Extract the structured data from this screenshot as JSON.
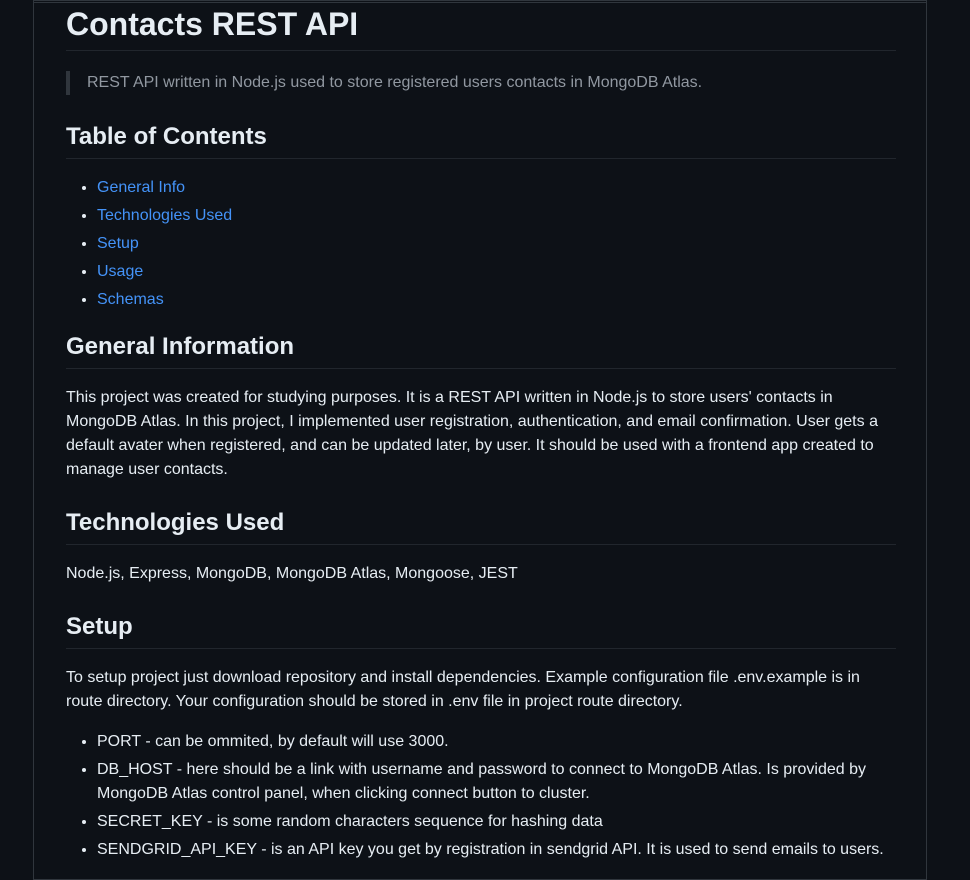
{
  "title": "Contacts REST API",
  "tagline": "REST API written in Node.js used to store registered users contacts in MongoDB Atlas.",
  "toc": {
    "heading": "Table of Contents",
    "items": [
      "General Info",
      "Technologies Used",
      "Setup",
      "Usage",
      "Schemas"
    ]
  },
  "general": {
    "heading": "General Information",
    "text": "This project was created for studying purposes. It is a REST API written in Node.js to store users' contacts in MongoDB Atlas. In this project, I implemented user registration, authentication, and email confirmation. User gets a default avater when registered, and can be updated later, by user. It should be used with a frontend app created to manage user contacts."
  },
  "technologies": {
    "heading": "Technologies Used",
    "text": "Node.js, Express, MongoDB, MongoDB Atlas, Mongoose, JEST"
  },
  "setup": {
    "heading": "Setup",
    "text": "To setup project just download repository and install dependencies. Example configuration file .env.example is in route directory. Your configuration should be stored in .env file in project route directory.",
    "items": [
      "PORT - can be ommited, by default will use 3000.",
      "DB_HOST - here should be a link with username and password to connect to MongoDB Atlas. Is provided by MongoDB Atlas control panel, when clicking connect button to cluster.",
      "SECRET_KEY - is some random characters sequence for hashing data",
      "SENDGRID_API_KEY - is an API key you get by registration in sendgrid API. It is used to send emails to users."
    ]
  }
}
